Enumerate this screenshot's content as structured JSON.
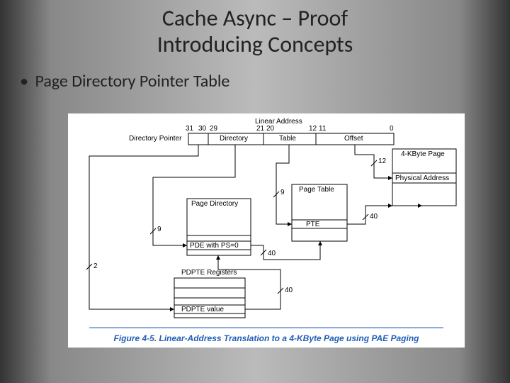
{
  "title_line1": "Cache Async – Proof",
  "title_line2": "Introducing Concepts",
  "bullet": "Page Directory Pointer Table",
  "diagram": {
    "linear_address_label": "Linear Address",
    "bits": {
      "b31": "31",
      "b30": "30",
      "b29": "29",
      "b21": "21",
      "b20": "20",
      "b12": "12",
      "b11": "11",
      "b0": "0"
    },
    "fields": {
      "dir_pointer": "Directory Pointer",
      "directory": "Directory",
      "table": "Table",
      "offset": "Offset"
    },
    "blocks": {
      "page_directory": "Page Directory",
      "pde": "PDE with PS=0",
      "page_table": "Page Table",
      "pte": "PTE",
      "page": "4-KByte Page",
      "phys": "Physical Address",
      "pdpte_regs": "PDPTE Registers",
      "pdpte_val": "PDPTE value"
    },
    "slashes": {
      "s2": "2",
      "s9a": "9",
      "s9b": "9",
      "s12": "12",
      "s40a": "40",
      "s40b": "40",
      "s40c": "40"
    }
  },
  "caption": "Figure 4-5.  Linear-Address Translation to a 4-KByte Page using PAE Paging"
}
